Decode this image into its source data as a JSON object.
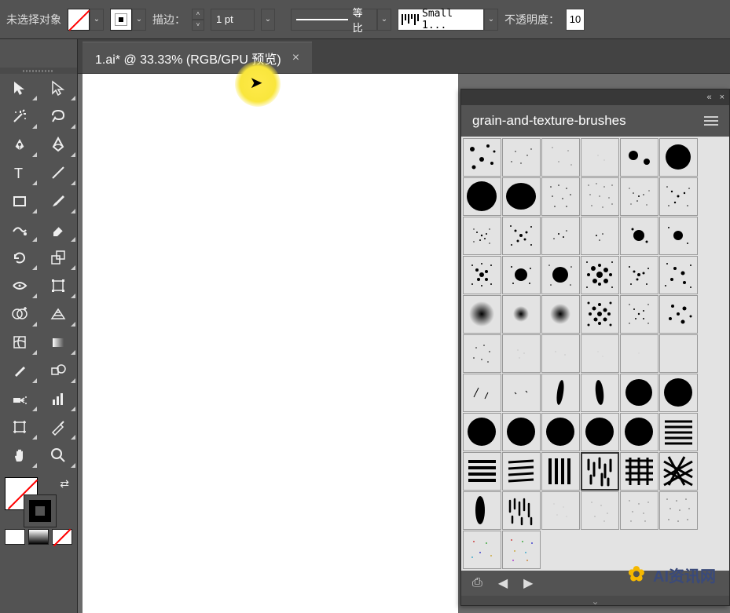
{
  "options": {
    "no_selection": "未选择对象",
    "stroke_label": "描边：",
    "stroke_weight": "1 pt",
    "profile_label": "等比",
    "brush_name": "Small 1...",
    "opacity_label": "不透明度：",
    "opacity_value": "10"
  },
  "tab": {
    "title": "1.ai* @ 33.33% (RGB/GPU 预览)",
    "close": "×"
  },
  "brushes": {
    "title": "grain-and-texture-brushes",
    "collapse": "«",
    "close": "×"
  },
  "watermark": {
    "text": "AI资讯网"
  }
}
